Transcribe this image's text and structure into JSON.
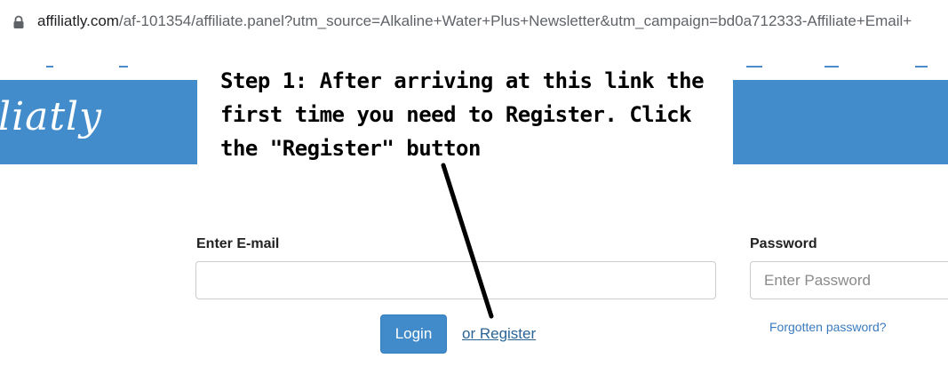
{
  "browser": {
    "url_domain": "affiliatly.com",
    "url_path": "/af-101354/affiliate.panel?utm_source=Alkaline+Water+Plus+Newsletter&utm_campaign=bd0a712333-Affiliate+Email+"
  },
  "banner": {
    "logo_text": "liatly",
    "color": "#438ccb"
  },
  "annotation": {
    "line1": "Step 1: After arriving at this link the",
    "line2": "first time you need to Register. Click",
    "line3": "the \"Register\" button"
  },
  "login_form": {
    "email_label": "Enter E-mail",
    "email_value": "",
    "password_label": "Password",
    "password_placeholder": "Enter Password",
    "login_button": "Login",
    "register_link": "or Register",
    "forgot_link": "Forgotten password?"
  },
  "colors": {
    "accent": "#428bca",
    "link": "#2a6496"
  }
}
